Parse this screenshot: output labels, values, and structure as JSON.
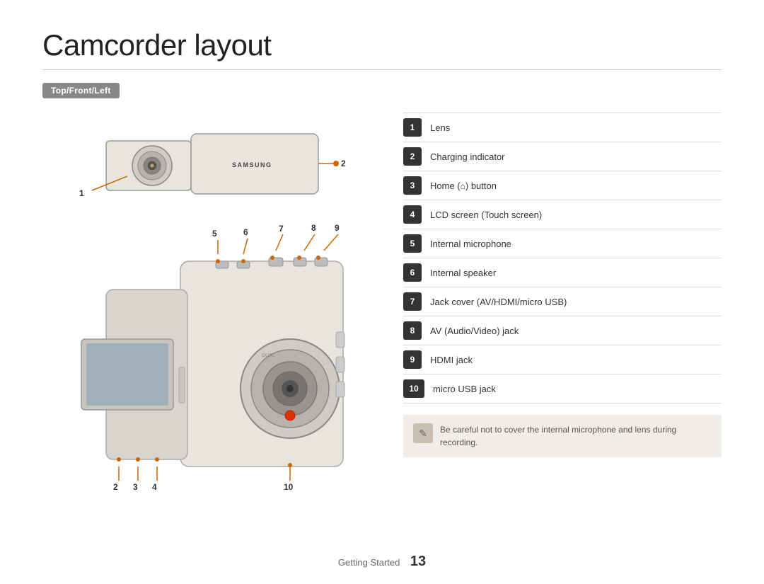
{
  "page": {
    "title": "Camcorder layout",
    "section_badge": "Top/Front/Left",
    "footer_text": "Getting Started",
    "footer_page": "13"
  },
  "labels": [
    {
      "num": "1",
      "text": "Lens"
    },
    {
      "num": "2",
      "text": "Charging indicator"
    },
    {
      "num": "3",
      "text": "Home (    ) button"
    },
    {
      "num": "4",
      "text": "LCD screen (Touch screen)"
    },
    {
      "num": "5",
      "text": "Internal microphone"
    },
    {
      "num": "6",
      "text": "Internal speaker"
    },
    {
      "num": "7",
      "text": "Jack cover (AV/HDMI/micro USB)"
    },
    {
      "num": "8",
      "text": "AV (Audio/Video) jack"
    },
    {
      "num": "9",
      "text": "HDMI jack"
    },
    {
      "num": "10",
      "text": "micro USB jack"
    }
  ],
  "note": {
    "icon": "✎",
    "text": "Be careful not to cover the internal microphone and lens during recording."
  }
}
